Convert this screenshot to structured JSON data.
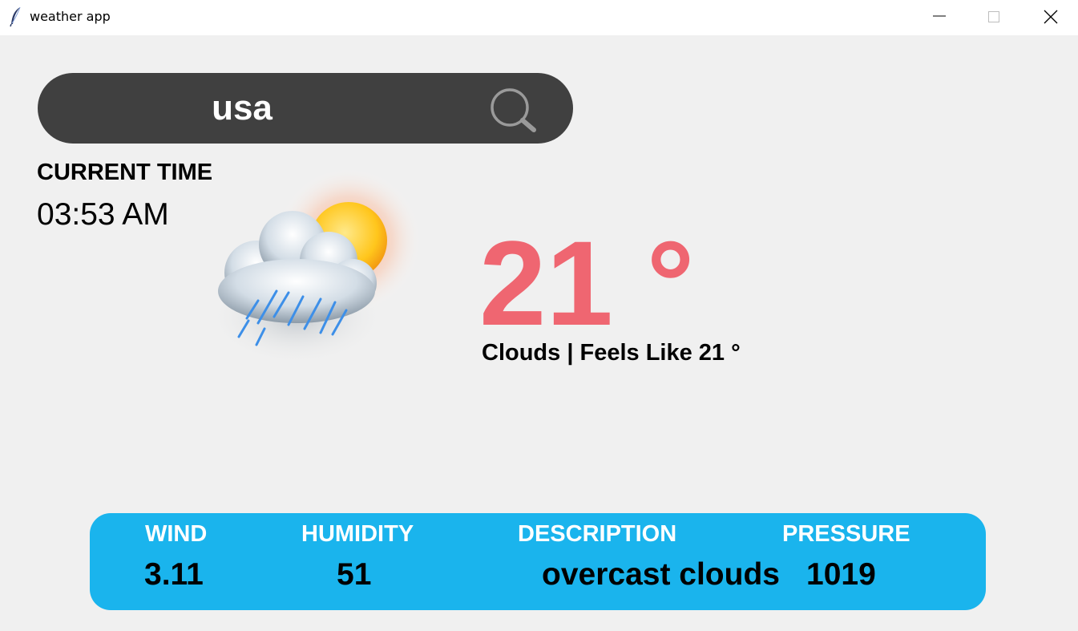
{
  "window": {
    "title": "weather app",
    "app_icon": "feather-icon",
    "controls": [
      "minimize-icon",
      "maximize-icon",
      "close-icon"
    ]
  },
  "search": {
    "value": "usa",
    "icon": "search-icon"
  },
  "time": {
    "heading": "CURRENT TIME",
    "value": "03:53 AM"
  },
  "weather": {
    "icon": "cloud-sun-rain-icon",
    "temperature": "21 °",
    "condition": "Clouds | Feels Like 21 °"
  },
  "info": {
    "wind_label": "WIND",
    "humidity_label": "HUMIDITY",
    "description_label": "DESCRIPTION",
    "pressure_label": "PRESSURE",
    "wind_value": "3.11",
    "humidity_value": "51",
    "description_value": "overcast clouds",
    "pressure_value": "1019"
  },
  "colors": {
    "temperature": "#ef6671",
    "info_panel": "#1ab4ed",
    "search_bar": "#404040",
    "background": "#f0f0f0"
  }
}
